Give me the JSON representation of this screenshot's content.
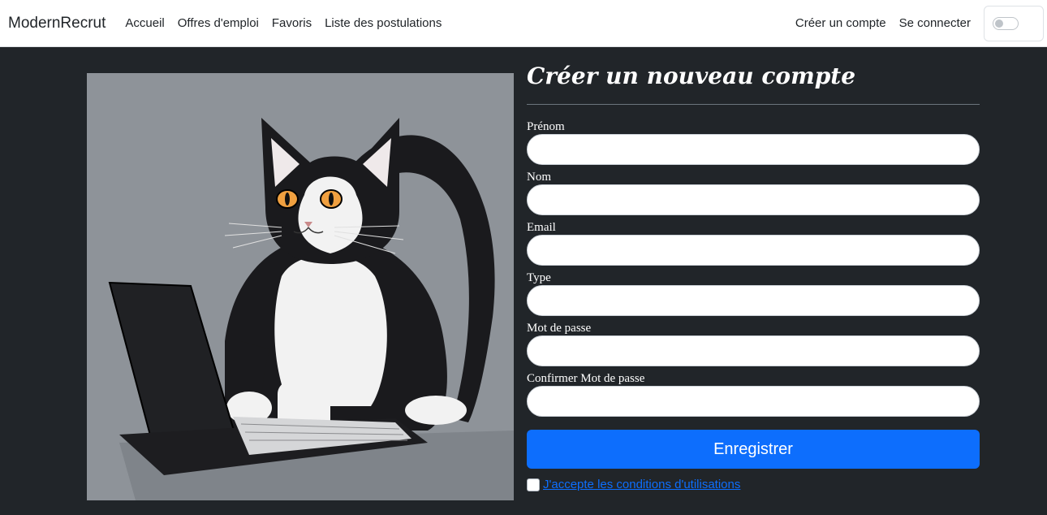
{
  "navbar": {
    "brand": "ModernRecrut",
    "links": [
      {
        "label": "Accueil"
      },
      {
        "label": "Offres d'emploi"
      },
      {
        "label": "Favoris"
      },
      {
        "label": "Liste des postulations"
      }
    ],
    "right_links": [
      {
        "label": "Créer un compte"
      },
      {
        "label": "Se connecter"
      }
    ],
    "theme_toggle": {
      "state": "off"
    }
  },
  "illustration": {
    "subject": "cat-using-laptop"
  },
  "form": {
    "title": "Créer un nouveau compte",
    "fields": [
      {
        "label": "Prénom",
        "value": "",
        "placeholder": ""
      },
      {
        "label": "Nom",
        "value": "",
        "placeholder": ""
      },
      {
        "label": "Email",
        "value": "",
        "placeholder": ""
      },
      {
        "label": "Type",
        "value": "",
        "placeholder": ""
      },
      {
        "label": "Mot de passe",
        "value": "",
        "placeholder": ""
      },
      {
        "label": "Confirmer Mot de passe",
        "value": "",
        "placeholder": ""
      }
    ],
    "submit_label": "Enregistrer",
    "terms_label": "J'accepte les conditions d'utilisations",
    "terms_checked": false
  },
  "colors": {
    "page_bg": "#212529",
    "navbar_bg": "#ffffff",
    "accent": "#0d6efd",
    "illustration_bg": "#8e9399"
  }
}
